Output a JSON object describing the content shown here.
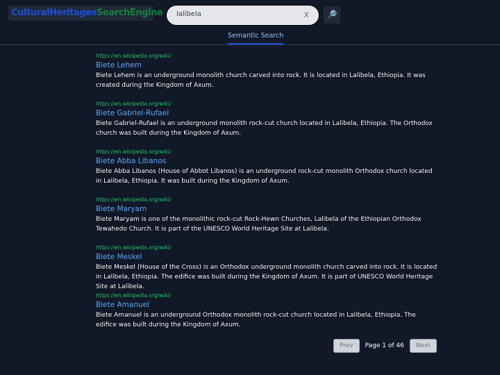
{
  "header": {
    "logo_part1": "CulturalHeritages",
    "logo_part2": "SearchEngine",
    "search_value": "lalibela",
    "clear_label": "X",
    "search_icon": "magnifier-icon"
  },
  "tabs": [
    {
      "label": "Semantic Search",
      "active": true
    }
  ],
  "results": [
    {
      "url": "https://en.wikipedia.org/wiki/",
      "title": "Biete Lehem",
      "desc": "Biete Lehem is an underground monolith church carved into rock. It is located in Lalibela, Ethiopia. It was created during the Kingdom of Axum."
    },
    {
      "url": "https://en.wikipedia.org/wiki/",
      "title": "Biete Gabriel-Rufael",
      "desc": "Biete Gabriel-Rufael is an underground monolith rock-cut church located in Lalibela, Ethiopia. The Orthodox church was built during the Kingdom of Axum."
    },
    {
      "url": "https://en.wikipedia.org/wiki/",
      "title": "Biete Abba Libanos",
      "desc": "Biete Abba Libanos (House of Abbot Libanos) is an underground rock-cut monolith Orthodox church located in Lalibela, Ethiopia. It was built during the Kingdom of Axum."
    },
    {
      "url": "https://en.wikipedia.org/wiki/",
      "title": "Biete Maryam",
      "desc": "Biete Maryam is one of the monolithic rock-cut Rock-Hewn Churches, Lalibela of the Ethiopian Orthodox Tewahedo Church. It is part of the UNESCO World Heritage Site at Lalibela."
    },
    {
      "url": "https://en.wikipedia.org/wiki/",
      "title": "Biete Meskel",
      "desc": "Biete Meskel (House of the Cross) is an Orthodox underground monolith church carved into rock. It is located in Lalibela, Ethiopia. The edifice was built during the Kingdom of Axum. It is part of UNESCO World Heritage Site at Lalibela."
    },
    {
      "url": "https://en.wikipedia.org/wiki/",
      "title": "Biete Amanuel",
      "desc": "Biete Amanuel is an underground Orthodox monolith rock-cut church located in Lalibela, Ethiopia. The edifice was built during the Kingdom of Axum."
    }
  ],
  "pagination": {
    "prev": "Prev",
    "page_text": "Page 1 of 46",
    "next": "Next"
  }
}
